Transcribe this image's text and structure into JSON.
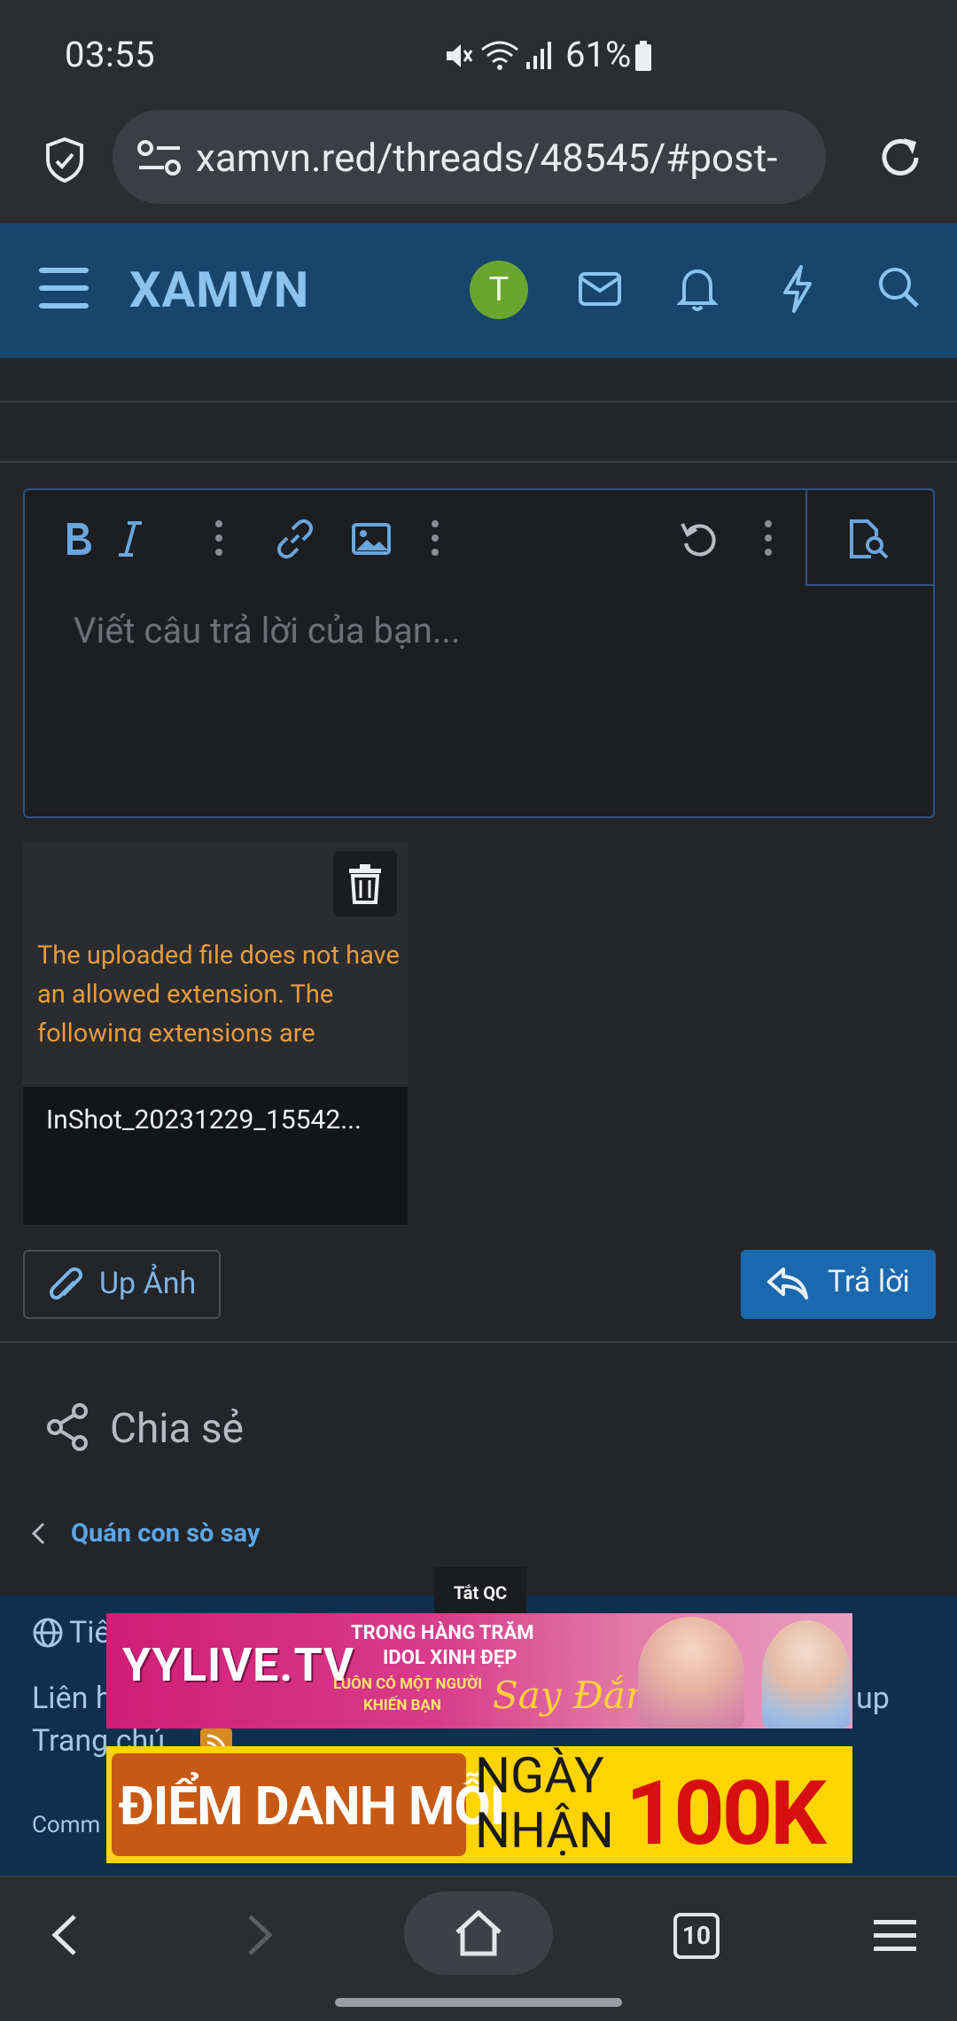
{
  "status_bar": {
    "time": "03:55",
    "battery": "61%"
  },
  "browser": {
    "url": "xamvn.red/threads/48545/#post-"
  },
  "header": {
    "logo": "XAMVN",
    "avatar_letter": "T"
  },
  "editor": {
    "placeholder": "Viết câu trả lời của bạn..."
  },
  "attachment": {
    "error": "The uploaded file does not have an allowed extension. The following extensions are allowed: .txt, .pdf, .png, .jpg,",
    "filename": "InShot_20231229_15542..."
  },
  "actions": {
    "upload_label": "Up Ảnh",
    "reply_label": "Trả lời"
  },
  "share": {
    "label": "Chia sẻ"
  },
  "breadcrumb": {
    "forum": "Quán con sò say"
  },
  "footer": {
    "lang": "Tiê",
    "contact": "Liên h",
    "home": "Trang chủ",
    "community": "Comm",
    "right_text": "up"
  },
  "ads": {
    "close_label": "Tắt QC",
    "ad1": {
      "brand": "YYLIVE.TV",
      "line1": "TRONG HÀNG TRĂM",
      "line2": "IDOL XINH ĐẸP",
      "line3": "LUÔN CÓ MỘT NGƯỜI",
      "line4": "KHIẾN BẠN",
      "line5": "Say Đắm"
    },
    "ad2": {
      "t1": "ĐIỂM DANH MỖI",
      "t2": "NGÀY",
      "t3": "NHẬN",
      "t4": "100K"
    }
  },
  "navbar": {
    "tab_count": "10"
  },
  "icons": [
    "mute-icon",
    "wifi-icon",
    "signal-icon",
    "battery-icon",
    "shield-icon",
    "site-settings-icon",
    "reload-icon",
    "menu-icon",
    "mail-icon",
    "bell-icon",
    "bolt-icon",
    "search-icon",
    "bold-icon",
    "italic-icon",
    "more-vertical-icon",
    "link-icon",
    "image-icon",
    "undo-icon",
    "preview-icon",
    "trash-icon",
    "paperclip-icon",
    "reply-icon",
    "share-icon",
    "chevron-left-icon",
    "globe-icon",
    "rss-icon",
    "back-icon",
    "forward-icon",
    "home-icon",
    "tabs-icon",
    "browser-menu-icon"
  ]
}
